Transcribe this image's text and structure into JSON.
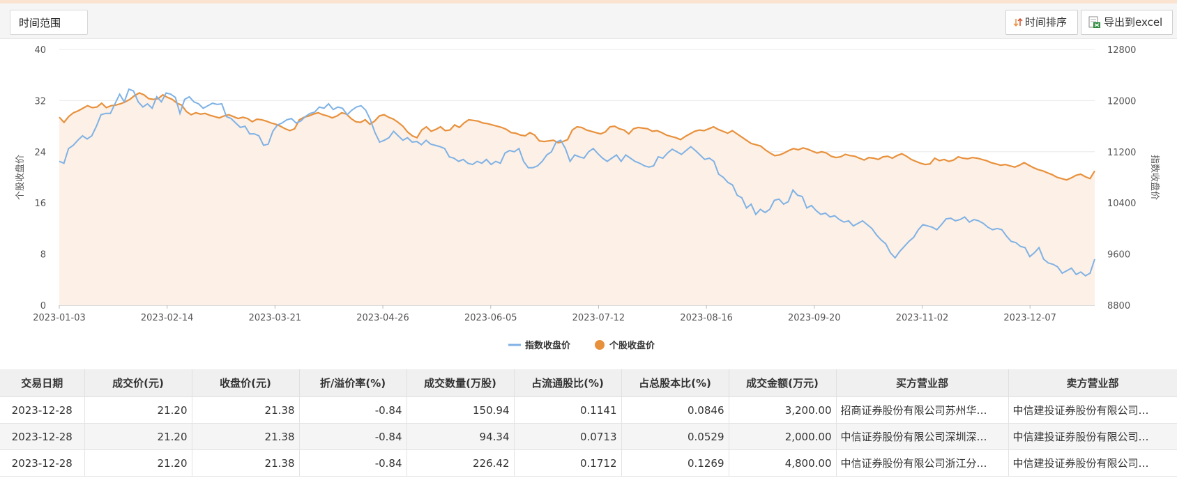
{
  "toolbar": {
    "range_label": "时间范围",
    "sort_label": "时间排序",
    "export_label": "导出到excel"
  },
  "chart_data": {
    "type": "line",
    "x_ticks": [
      "2023-01-03",
      "2023-02-14",
      "2023-03-21",
      "2023-04-26",
      "2023-06-05",
      "2023-07-12",
      "2023-08-16",
      "2023-09-20",
      "2023-11-02",
      "2023-12-07"
    ],
    "y_left_label": "个股收盘价",
    "y_left_ticks": [
      "0",
      "8",
      "16",
      "24",
      "32",
      "40"
    ],
    "y_left_range": [
      0,
      40
    ],
    "y_right_label": "指数收盘价",
    "y_right_ticks": [
      "8800",
      "9600",
      "10400",
      "11200",
      "12000",
      "12800"
    ],
    "y_right_range": [
      8800,
      12800
    ],
    "legend_position": "bottom-center",
    "grid": true,
    "series": [
      {
        "name": "个股收盘价",
        "axis": "left",
        "color": "#e8913d",
        "area_fill": "#fdf0e6",
        "values": [
          29.4,
          28.6,
          29.5,
          30.1,
          30.4,
          30.8,
          31.2,
          30.9,
          31.0,
          31.6,
          30.9,
          31.2,
          31.3,
          31.5,
          31.8,
          32.2,
          32.8,
          33.2,
          32.9,
          32.3,
          32.2,
          32.3,
          32.9,
          32.5,
          32.2,
          31.6,
          31.3,
          30.3,
          29.8,
          30.1,
          29.9,
          30.0,
          29.7,
          29.5,
          29.3,
          29.6,
          29.8,
          29.5,
          29.2,
          29.4,
          29.2,
          28.7,
          29.1,
          29.0,
          28.8,
          28.5,
          28.3,
          28.0,
          27.6,
          27.3,
          27.6,
          29.0,
          29.4,
          29.6,
          29.9,
          30.1,
          29.8,
          29.6,
          29.3,
          29.6,
          30.1,
          29.9,
          29.2,
          28.7,
          28.6,
          29.0,
          28.3,
          28.8,
          29.6,
          29.8,
          29.4,
          29.1,
          28.6,
          28.0,
          27.1,
          26.5,
          26.2,
          27.4,
          27.9,
          27.2,
          27.5,
          27.9,
          27.3,
          27.4,
          28.2,
          27.8,
          28.5,
          29.0,
          28.9,
          28.8,
          28.5,
          28.4,
          28.2,
          28.0,
          27.8,
          27.5,
          27.0,
          26.9,
          26.6,
          26.5,
          27.0,
          26.6,
          25.7,
          25.6,
          25.7,
          25.8,
          25.4,
          25.6,
          25.9,
          27.4,
          27.9,
          27.8,
          27.4,
          27.2,
          27.0,
          26.8,
          27.1,
          27.9,
          28.0,
          27.6,
          27.4,
          26.8,
          27.6,
          27.8,
          27.7,
          27.6,
          27.2,
          27.3,
          27.0,
          26.6,
          26.4,
          26.2,
          25.9,
          26.4,
          26.8,
          27.2,
          27.4,
          27.3,
          27.6,
          27.9,
          27.5,
          27.2,
          26.9,
          27.3,
          26.8,
          26.3,
          25.8,
          25.3,
          25.1,
          24.9,
          24.3,
          23.8,
          23.4,
          23.5,
          23.8,
          24.2,
          24.5,
          24.3,
          24.6,
          24.4,
          24.1,
          23.8,
          24.0,
          23.8,
          23.3,
          23.1,
          23.2,
          23.6,
          23.4,
          23.3,
          23.0,
          22.7,
          23.1,
          23.0,
          22.8,
          23.2,
          23.3,
          23.0,
          23.4,
          23.7,
          23.3,
          22.8,
          22.5,
          22.2,
          22.0,
          22.1,
          23.0,
          22.6,
          22.8,
          22.5,
          22.7,
          23.2,
          23.0,
          22.9,
          23.1,
          23.0,
          22.8,
          22.6,
          22.3,
          22.1,
          21.9,
          22.0,
          21.8,
          21.6,
          21.9,
          22.3,
          21.9,
          21.5,
          21.2,
          21.0,
          20.7,
          20.4,
          20.0,
          19.8,
          19.6,
          19.9,
          20.3,
          20.5,
          20.1,
          19.8,
          21.0
        ]
      },
      {
        "name": "指数收盘价",
        "axis": "right",
        "color": "#7fb2e5",
        "values": [
          11050,
          11020,
          11250,
          11300,
          11380,
          11450,
          11400,
          11450,
          11600,
          11780,
          11800,
          11800,
          11950,
          12100,
          11980,
          12180,
          12150,
          11980,
          11900,
          11950,
          11880,
          12060,
          11980,
          12120,
          12100,
          12050,
          11800,
          12020,
          12060,
          11980,
          11950,
          11880,
          11920,
          11960,
          11940,
          11950,
          11750,
          11720,
          11650,
          11580,
          11600,
          11480,
          11480,
          11450,
          11300,
          11320,
          11520,
          11620,
          11650,
          11700,
          11720,
          11650,
          11680,
          11750,
          11800,
          11820,
          11900,
          11880,
          11950,
          11860,
          11900,
          11880,
          11780,
          11850,
          11900,
          11920,
          11850,
          11700,
          11500,
          11350,
          11380,
          11420,
          11520,
          11450,
          11380,
          11420,
          11350,
          11360,
          11310,
          11380,
          11320,
          11300,
          11280,
          11250,
          11120,
          11100,
          11050,
          11080,
          11020,
          11000,
          11050,
          11020,
          11080,
          11000,
          11050,
          11020,
          11180,
          11220,
          11200,
          11250,
          11050,
          10950,
          10950,
          10980,
          11050,
          11150,
          11200,
          11350,
          11380,
          11250,
          11050,
          11150,
          11120,
          11100,
          11200,
          11250,
          11170,
          11100,
          11050,
          11100,
          11150,
          11050,
          11150,
          11100,
          11050,
          11020,
          10980,
          10960,
          10980,
          11120,
          11100,
          11180,
          11240,
          11200,
          11160,
          11220,
          11280,
          11220,
          11150,
          11080,
          11100,
          11050,
          10850,
          10800,
          10720,
          10680,
          10520,
          10480,
          10320,
          10380,
          10220,
          10300,
          10250,
          10300,
          10440,
          10460,
          10380,
          10420,
          10600,
          10520,
          10500,
          10320,
          10360,
          10280,
          10220,
          10240,
          10180,
          10200,
          10140,
          10100,
          10120,
          10040,
          10080,
          10120,
          10060,
          10000,
          9900,
          9820,
          9760,
          9620,
          9540,
          9640,
          9720,
          9800,
          9860,
          9980,
          10060,
          10040,
          10020,
          9980,
          10060,
          10150,
          10160,
          10120,
          10140,
          10180,
          10100,
          10140,
          10120,
          10080,
          10020,
          9980,
          10000,
          9980,
          9880,
          9800,
          9780,
          9720,
          9700,
          9560,
          9620,
          9700,
          9520,
          9460,
          9440,
          9400,
          9300,
          9340,
          9380,
          9280,
          9320,
          9260,
          9300,
          9520
        ]
      }
    ]
  },
  "table": {
    "columns": [
      "交易日期",
      "成交价(元)",
      "收盘价(元)",
      "折/溢价率(%)",
      "成交数量(万股)",
      "占流通股比(%)",
      "占总股本比(%)",
      "成交金额(万元)",
      "买方营业部",
      "卖方营业部"
    ],
    "rows": [
      [
        "2023-12-28",
        "21.20",
        "21.38",
        "-0.84",
        "150.94",
        "0.1141",
        "0.0846",
        "3,200.00",
        "招商证券股份有限公司苏州华…",
        "中信建投证券股份有限公司…"
      ],
      [
        "2023-12-28",
        "21.20",
        "21.38",
        "-0.84",
        "94.34",
        "0.0713",
        "0.0529",
        "2,000.00",
        "中信证券股份有限公司深圳深…",
        "中信建投证券股份有限公司…"
      ],
      [
        "2023-12-28",
        "21.20",
        "21.38",
        "-0.84",
        "226.42",
        "0.1712",
        "0.1269",
        "4,800.00",
        "中信证券股份有限公司浙江分…",
        "中信建投证券股份有限公司…"
      ]
    ]
  }
}
